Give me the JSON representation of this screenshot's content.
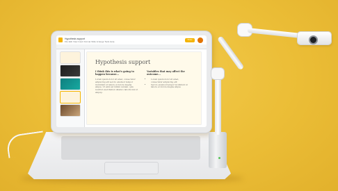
{
  "scene": "Laptop showing a slide presentation next to a document camera on a yellow background",
  "colors": {
    "background": "#ebbd36",
    "slide_background": "#fffaea",
    "accent": "#f4b400",
    "camera_led": "#58c458"
  },
  "slides_app": {
    "doc_title": "Hypothesis support",
    "menu": "File  Edit  View  Insert  Format  Slide  Arrange  Tools  Help",
    "share_label": "Share",
    "slide": {
      "title": "Hypothesis support",
      "left_heading": "I think this is what's going to happen because...",
      "left_body": "Lorem ipsum dolor sit amet, consectetur adipiscing elit sed do eiusmod tempor incididunt ut labore et dolore magna aliqua. Ut enim ad minim veniam, quis nostrud exercitation ullamco laboris nisi ut aliquip.",
      "right_heading": "Variables that may affect the outcome...",
      "right_bullets": [
        "Lorem ipsum dolor sit amet, consectetur adipiscing elit",
        "Sed do eiusmod tempor incididunt ut labore et dolore magna aliqua"
      ]
    }
  }
}
